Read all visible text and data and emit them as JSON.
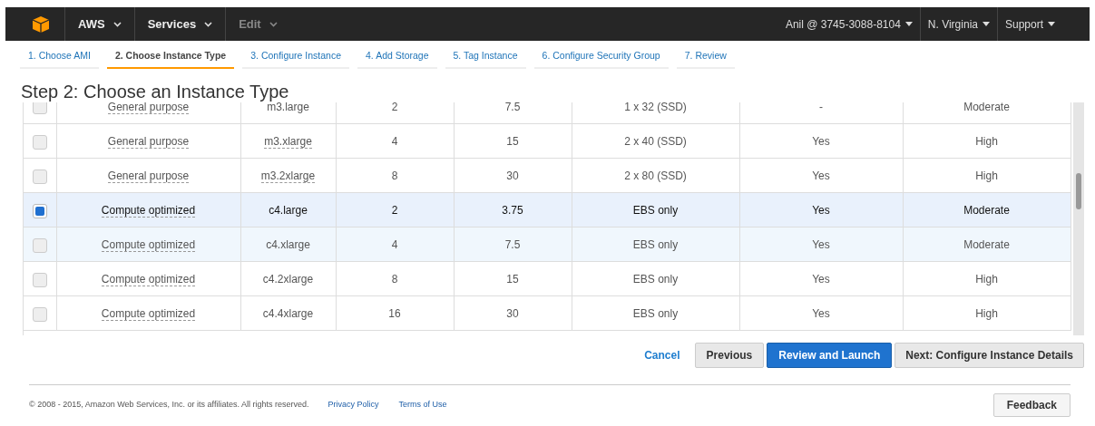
{
  "top_bar": {
    "left_menus": [
      {
        "label": "AWS",
        "disabled": false
      },
      {
        "label": "Services",
        "disabled": false
      },
      {
        "label": "Edit",
        "disabled": true
      }
    ],
    "right_menus": [
      "Anil @ 3745-3088-8104",
      "N. Virginia",
      "Support"
    ]
  },
  "steps": [
    {
      "label": "1. Choose AMI",
      "selected": false
    },
    {
      "label": "2. Choose Instance Type",
      "selected": true
    },
    {
      "label": "3. Configure Instance",
      "selected": false
    },
    {
      "label": "4. Add Storage",
      "selected": false
    },
    {
      "label": "5. Tag Instance",
      "selected": false
    },
    {
      "label": "6. Configure Security Group",
      "selected": false
    },
    {
      "label": "7. Review",
      "selected": false
    }
  ],
  "title": "Step 2: Choose an Instance Type",
  "table": {
    "rows": [
      {
        "selected": false,
        "hovered": false,
        "cells": [
          "General purpose",
          "m3.large",
          "2",
          "7.5",
          "1 x 32 (SSD)",
          "-",
          "Moderate"
        ]
      },
      {
        "selected": false,
        "hovered": false,
        "cells": [
          "General purpose",
          "m3.xlarge",
          "4",
          "15",
          "2 x 40 (SSD)",
          "Yes",
          "High"
        ]
      },
      {
        "selected": false,
        "hovered": false,
        "cells": [
          "General purpose",
          "m3.2xlarge",
          "8",
          "30",
          "2 x 80 (SSD)",
          "Yes",
          "High"
        ]
      },
      {
        "selected": true,
        "hovered": false,
        "cells": [
          "Compute optimized",
          "c4.large",
          "2",
          "3.75",
          "EBS only",
          "Yes",
          "Moderate"
        ]
      },
      {
        "selected": false,
        "hovered": true,
        "cells": [
          "Compute optimized",
          "c4.xlarge",
          "4",
          "7.5",
          "EBS only",
          "Yes",
          "Moderate"
        ]
      },
      {
        "selected": false,
        "hovered": false,
        "cells": [
          "Compute optimized",
          "c4.2xlarge",
          "8",
          "15",
          "EBS only",
          "Yes",
          "High"
        ]
      },
      {
        "selected": false,
        "hovered": false,
        "cells": [
          "Compute optimized",
          "c4.4xlarge",
          "16",
          "30",
          "EBS only",
          "Yes",
          "High"
        ]
      }
    ]
  },
  "actions": {
    "cancel": "Cancel",
    "previous": "Previous",
    "review": "Review and Launch",
    "next": "Next: Configure Instance Details"
  },
  "footer": {
    "copyright": "© 2008 - 2015, Amazon Web Services, Inc. or its affiliates. All rights reserved.",
    "links": [
      "Privacy Policy",
      "Terms of Use"
    ],
    "feedback": "Feedback"
  }
}
